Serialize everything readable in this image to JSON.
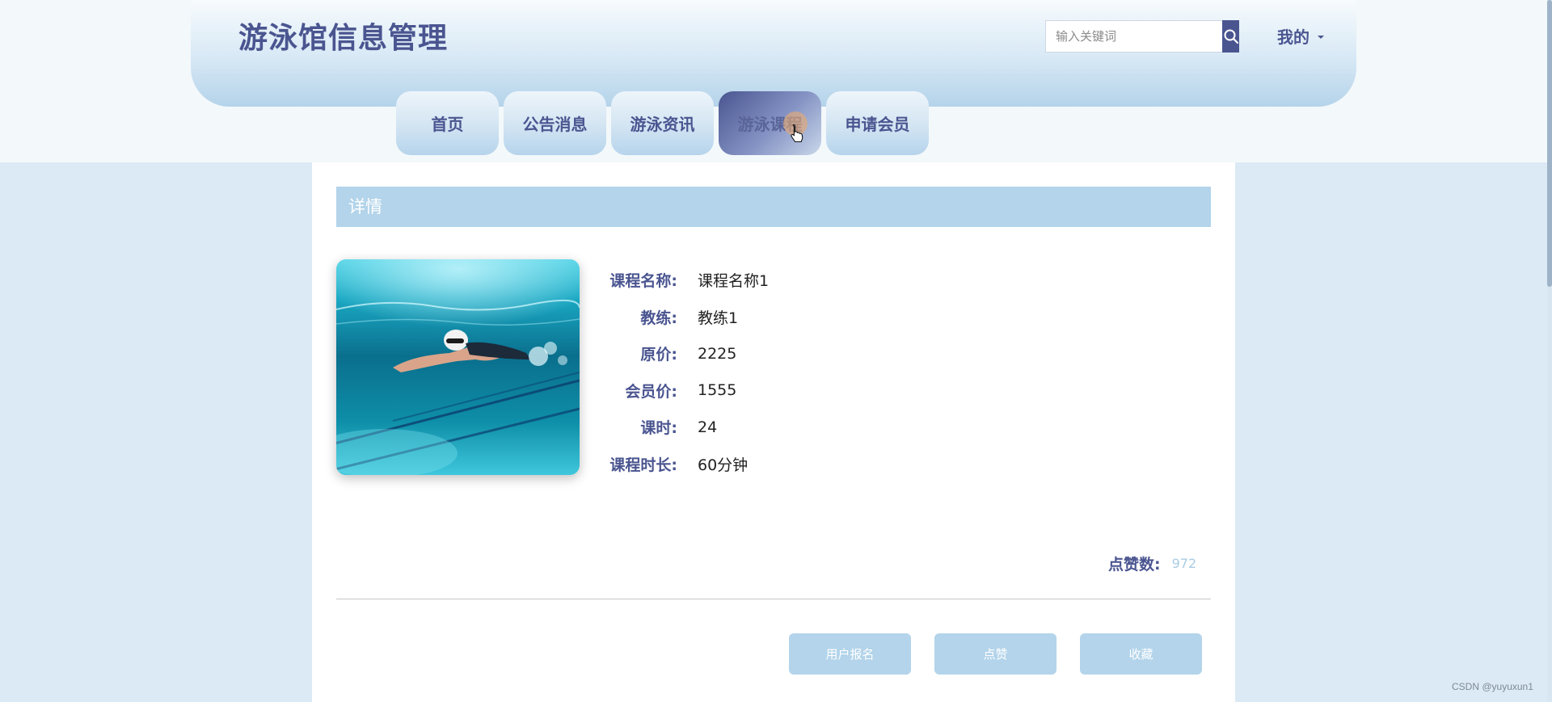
{
  "site": {
    "title": "游泳馆信息管理"
  },
  "search": {
    "placeholder": "输入关键词"
  },
  "user_menu": {
    "label": "我的"
  },
  "nav": {
    "items": [
      {
        "label": "首页"
      },
      {
        "label": "公告消息"
      },
      {
        "label": "游泳资讯"
      },
      {
        "label": "游泳课程",
        "active": true
      },
      {
        "label": "申请会员"
      }
    ]
  },
  "detail": {
    "header": "详情",
    "image": "swimmer-underwater-photo",
    "fields": [
      {
        "label": "课程名称:",
        "value": "课程名称1"
      },
      {
        "label": "教练:",
        "value": "教练1"
      },
      {
        "label": "原价:",
        "value": "2225"
      },
      {
        "label": "会员价:",
        "value": "1555"
      },
      {
        "label": "课时:",
        "value": "24"
      },
      {
        "label": "课程时长:",
        "value": "60分钟"
      }
    ],
    "likes_label": "点赞数:",
    "likes_value": "972"
  },
  "actions": {
    "signup": "用户报名",
    "like": "点赞",
    "favorite": "收藏"
  },
  "watermark": "CSDN @yuyuxun1",
  "colors": {
    "brand": "#4a5590",
    "accent": "#b3d4ea",
    "page_bg": "#dbeaf5"
  },
  "icons": {
    "search": "search-icon",
    "caret": "caret-down-icon",
    "cursor": "hand-cursor-icon"
  }
}
